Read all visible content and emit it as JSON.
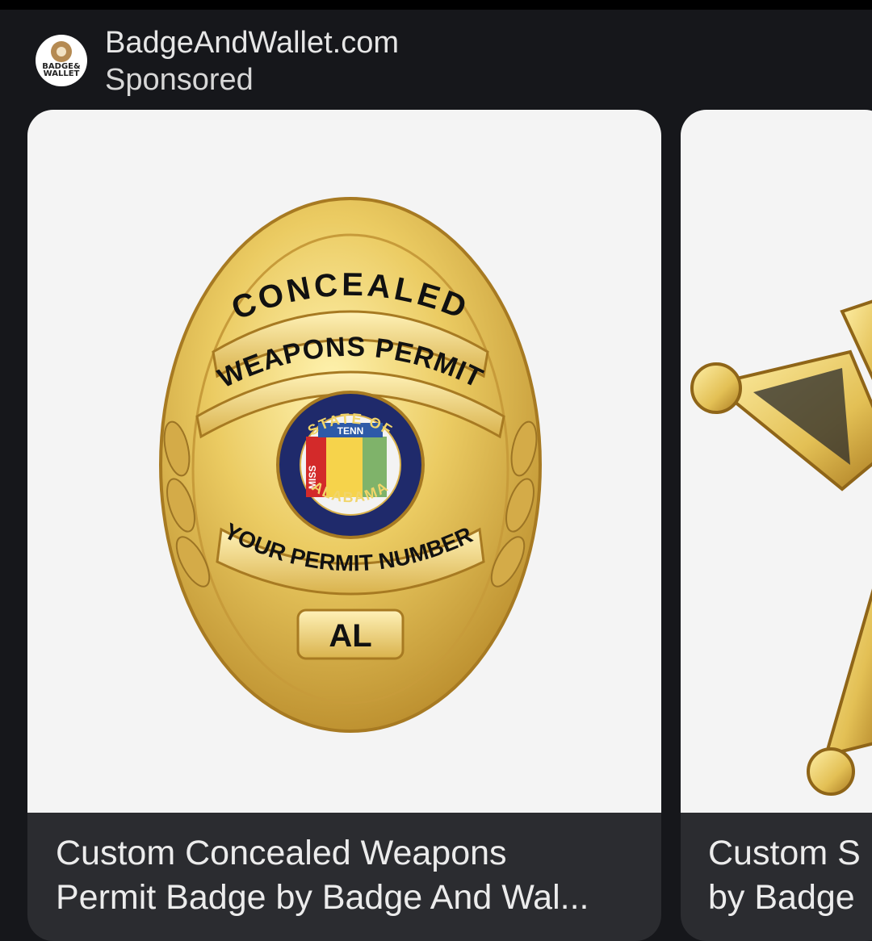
{
  "ad": {
    "advertiser": "BadgeAndWallet.com",
    "sponsored": "Sponsored",
    "logo_text": "BADGE&\nWALLET"
  },
  "cards": [
    {
      "caption_line1": "Custom Concealed Weapons",
      "caption_line2": "Permit Badge by Badge And Wal...",
      "badge": {
        "top_banner": "CONCEALED",
        "second_banner": "WEAPONS PERMIT",
        "seal_top": "STATE OF",
        "seal_bottom": "ALABAMA",
        "seal_tenn": "TENN",
        "seal_miss": "MISS",
        "bottom_banner": "YOUR PERMIT NUMBER",
        "plate": "AL"
      }
    },
    {
      "caption_line1": "Custom S",
      "caption_line2": "by Badge"
    }
  ],
  "colors": {
    "background": "#16171b",
    "card_footer": "#2b2c30",
    "gold": "#e0c15a",
    "seal_blue": "#1f2a6b"
  }
}
